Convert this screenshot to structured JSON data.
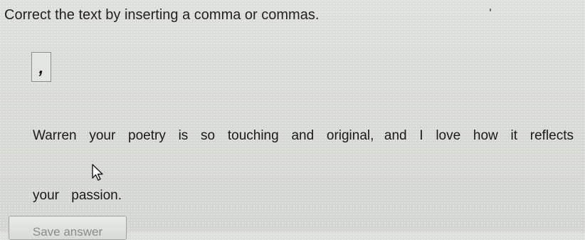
{
  "instruction": "Correct the text by inserting a comma or commas.",
  "tile": {
    "symbol": ","
  },
  "sentence": {
    "line1": [
      {
        "word": "Warren",
        "after": ""
      },
      {
        "word": "your",
        "after": ""
      },
      {
        "word": "poetry",
        "after": ""
      },
      {
        "word": "is",
        "after": ""
      },
      {
        "word": "so",
        "after": ""
      },
      {
        "word": "touching",
        "after": ""
      },
      {
        "word": "and",
        "after": ""
      },
      {
        "word": "original",
        "after": ","
      },
      {
        "word": "and",
        "after": ""
      },
      {
        "word": "I",
        "after": ""
      },
      {
        "word": "love",
        "after": ""
      },
      {
        "word": "how",
        "after": ""
      },
      {
        "word": "it",
        "after": ""
      },
      {
        "word": "reflects",
        "after": ""
      }
    ],
    "line2": [
      {
        "word": "your",
        "after": ""
      },
      {
        "word": "passion",
        "after": "."
      }
    ]
  },
  "save_button": {
    "label": "Save answer"
  },
  "icons": {
    "cursor": "pointer-arrow-icon",
    "tick": "stray-mark"
  }
}
